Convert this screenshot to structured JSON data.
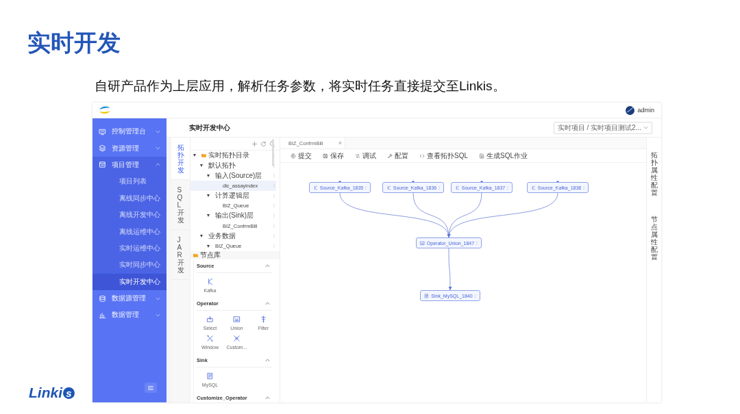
{
  "slide": {
    "title": "实时开发",
    "subtitle": "自研产品作为上层应用，解析任务参数，将实时任务直接提交至Linkis。",
    "logo_text": "Linki",
    "logo_badge": "s"
  },
  "app": {
    "user": "admin",
    "page_title": "实时开发中心",
    "project_selector": "实时项目 / 实时项目测试2...",
    "sidebar": [
      {
        "label": "控制管理台",
        "expanded": false,
        "selected": false
      },
      {
        "label": "资源管理",
        "expanded": false,
        "selected": false
      },
      {
        "label": "项目管理",
        "expanded": true,
        "selected": false,
        "children": [
          {
            "label": "项目列表",
            "selected": false
          },
          {
            "label": "离线同步中心",
            "selected": false
          },
          {
            "label": "离线开发中心",
            "selected": false
          },
          {
            "label": "离线运维中心",
            "selected": false
          },
          {
            "label": "实时运维中心",
            "selected": false
          },
          {
            "label": "实时同步中心",
            "selected": false
          },
          {
            "label": "实时开发中心",
            "selected": true
          }
        ]
      },
      {
        "label": "数据源管理",
        "expanded": false,
        "selected": false
      },
      {
        "label": "数据管理",
        "expanded": false,
        "selected": false
      }
    ],
    "side_tabs": [
      {
        "label": "拓扑开发",
        "selected": true
      },
      {
        "label": "SQL开发",
        "selected": false
      },
      {
        "label": "JAR开发",
        "selected": false
      }
    ],
    "tree": [
      {
        "label": "实时拓扑目录",
        "kind": "folder",
        "expanded": true,
        "selected": false,
        "children": [
          {
            "label": "默认拓扑",
            "expanded": true,
            "selected": false,
            "children": [
              {
                "label": "输入(Source)层",
                "expanded": true,
                "selected": false,
                "children": [
                  {
                    "label": "dic_assayindex",
                    "selected": true
                  }
                ]
              },
              {
                "label": "计算逻辑层",
                "expanded": true,
                "selected": false,
                "children": [
                  {
                    "label": "BIZ_Queue",
                    "selected": false
                  }
                ]
              },
              {
                "label": "输出(Sink)层",
                "expanded": true,
                "selected": false,
                "children": [
                  {
                    "label": "BIZ_ConfrmBill",
                    "selected": false
                  }
                ]
              }
            ]
          },
          {
            "label": "业务数据",
            "expanded": true,
            "selected": false,
            "children": [
              {
                "label": "BIZ_Queue",
                "expanded": true,
                "selected": false
              }
            ]
          }
        ]
      }
    ],
    "library_title": "节点库",
    "library": [
      {
        "title": "Source",
        "expanded": true,
        "items": [
          {
            "label": "Kafka"
          }
        ]
      },
      {
        "title": "Operator",
        "expanded": true,
        "items": [
          {
            "label": "Select"
          },
          {
            "label": "Union"
          },
          {
            "label": "Filter"
          },
          {
            "label": "Window"
          },
          {
            "label": "Custom..."
          }
        ]
      },
      {
        "title": "Sink",
        "expanded": true,
        "items": [
          {
            "label": "MySQL"
          }
        ]
      },
      {
        "title": "Customize_Operator",
        "expanded": true
      }
    ],
    "editor_tabs": [
      {
        "label": "BIZ_ConfrmBill",
        "close": "×"
      }
    ],
    "toolbar": [
      {
        "label": "提交"
      },
      {
        "label": "保存"
      },
      {
        "label": "调试"
      },
      {
        "label": "配置"
      },
      {
        "label": "查看拓扑SQL"
      },
      {
        "label": "生成SQL作业"
      }
    ],
    "graph": {
      "nodes": [
        {
          "label": "Source_Kafka_1835",
          "kind": "source"
        },
        {
          "label": "Source_Kafka_1836",
          "kind": "source"
        },
        {
          "label": "Source_Kafka_1837",
          "kind": "source"
        },
        {
          "label": "Source_Kafka_1838",
          "kind": "source"
        },
        {
          "label": "Operator_Union_1847",
          "kind": "union"
        },
        {
          "label": "Sink_MySQL_1840",
          "kind": "sink"
        }
      ]
    },
    "right_panel": [
      "拓扑属性配置",
      "节点属性配置"
    ]
  }
}
